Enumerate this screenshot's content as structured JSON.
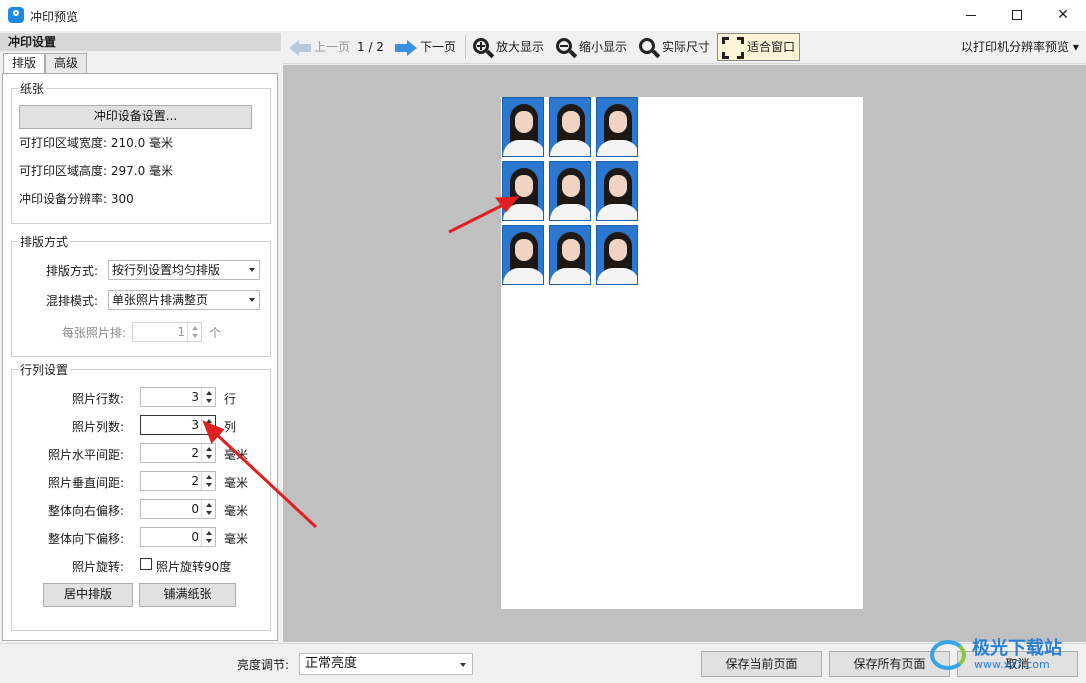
{
  "window": {
    "title": "冲印预览",
    "accent": "#1e88e5"
  },
  "left_panel": {
    "header": "冲印设置",
    "tabs": [
      {
        "label": "排版",
        "active": true
      },
      {
        "label": "高级",
        "active": false
      }
    ],
    "paper": {
      "title": "纸张",
      "settings_button": "冲印设备设置...",
      "width_text": "可打印区域宽度: 210.0 毫米",
      "height_text": "可打印区域高度: 297.0 毫米",
      "resolution_text": "冲印设备分辨率: 300"
    },
    "layout": {
      "title": "排版方式",
      "mode_label": "排版方式:",
      "mode_value": "按行列设置均匀排版",
      "mix_label": "混排模式:",
      "mix_value": "单张照片排满整页",
      "per_sheet_label": "每张照片排:",
      "per_sheet_value": "1",
      "per_sheet_unit": "个"
    },
    "grid": {
      "title": "行列设置",
      "rows_label": "照片行数:",
      "rows_value": "3",
      "rows_unit": "行",
      "cols_label": "照片列数:",
      "cols_value": "3",
      "cols_unit": "列",
      "hgap_label": "照片水平间距:",
      "hgap_value": "2",
      "hgap_unit": "毫米",
      "vgap_label": "照片垂直间距:",
      "vgap_value": "2",
      "vgap_unit": "毫米",
      "xoff_label": "整体向右偏移:",
      "xoff_value": "0",
      "xoff_unit": "毫米",
      "yoff_label": "整体向下偏移:",
      "yoff_value": "0",
      "yoff_unit": "毫米",
      "rotate_label": "照片旋转:",
      "rotate_checkbox": "照片旋转90度",
      "rotate_checked": false,
      "center_button": "居中排版",
      "fill_button": "铺满纸张"
    }
  },
  "toolbar": {
    "prev": "上一页",
    "page": "1 / 2",
    "next": "下一页",
    "zoom_in": "放大显示",
    "zoom_out": "缩小显示",
    "actual": "实际尺寸",
    "fit": "适合窗口",
    "preview_mode": "以打印机分辨率预览"
  },
  "preview": {
    "photo_rows": 3,
    "photo_cols": 3,
    "photo_bg": "#2a78d0",
    "annotation_color": "#e02020"
  },
  "bottom": {
    "brightness_label": "亮度调节:",
    "brightness_value": "正常亮度",
    "save_current": "保存当前页面",
    "save_all": "保存所有页面",
    "cancel": "取消"
  },
  "watermark": {
    "text": "极光下载站",
    "url": "www.xz7.com"
  }
}
